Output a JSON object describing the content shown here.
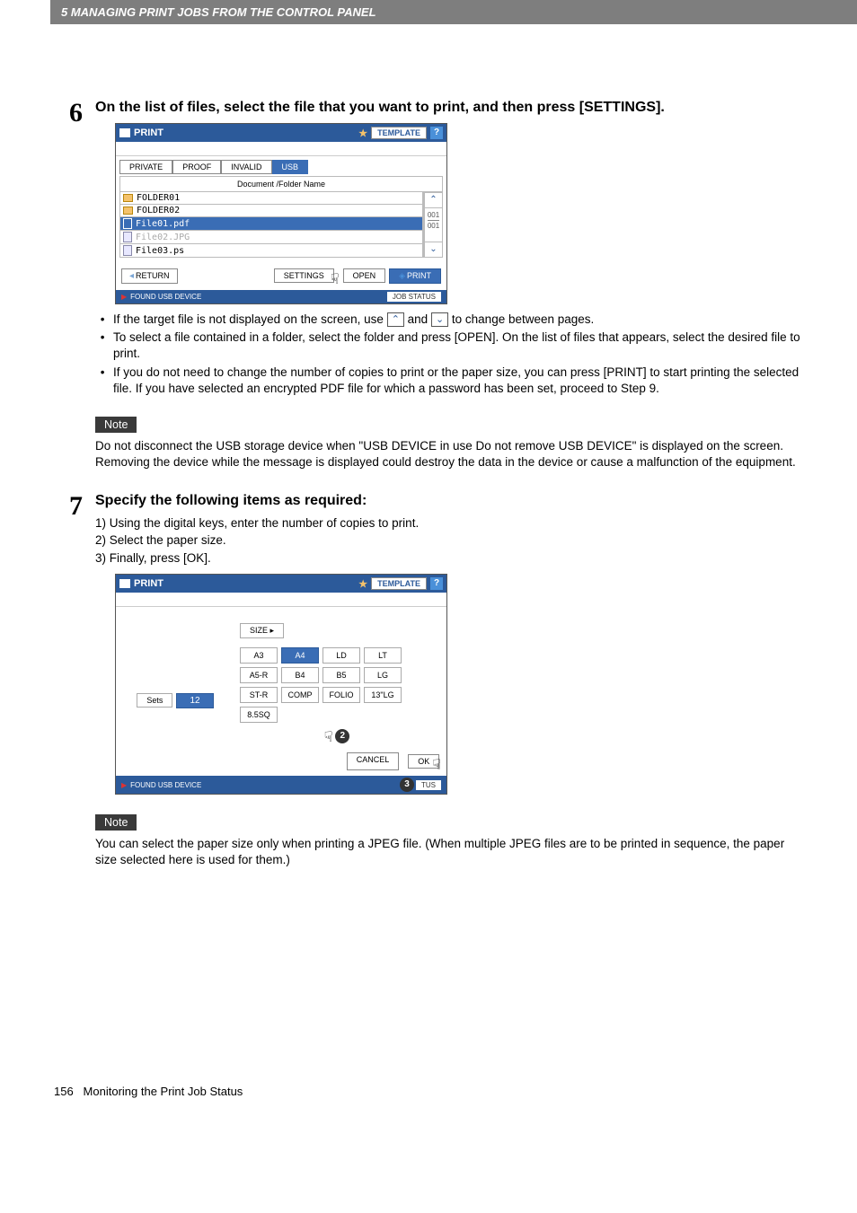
{
  "header": "5 MANAGING PRINT JOBS FROM THE CONTROL PANEL",
  "step6": {
    "num": "6",
    "heading": "On the list of files, select the file that you want to print, and then press [SETTINGS].",
    "ss": {
      "title": "PRINT",
      "template_btn": "TEMPLATE",
      "help": "?",
      "tabs": [
        "PRIVATE",
        "PROOF",
        "INVALID",
        "USB"
      ],
      "active_tab_index": 3,
      "list_header": "Document /Folder Name",
      "rows": [
        {
          "icon": "folder",
          "label": "FOLDER01"
        },
        {
          "icon": "folder",
          "label": "FOLDER02"
        },
        {
          "icon": "file",
          "label": "File01.pdf",
          "selected": true
        },
        {
          "icon": "file",
          "label": "File02.JPG",
          "dim": true
        },
        {
          "icon": "file",
          "label": "File03.ps"
        }
      ],
      "scroll": {
        "up": "⌃",
        "down": "⌄",
        "pg1": "001",
        "pg2": "001"
      },
      "return_btn": "RETURN",
      "settings_btn": "SETTINGS",
      "open_btn": "OPEN",
      "print_btn": "PRINT",
      "status_left": "FOUND USB DEVICE",
      "job_status": "JOB STATUS"
    },
    "bullets": [
      "If the target file is not displayed on the screen, use __UP__ and __DOWN__ to change between pages.",
      "To select a file contained in a folder, select the folder and press [OPEN]. On the list of files that appears, select the desired file to print.",
      "If you do not need to change the number of copies to print or the paper size, you can press [PRINT] to start printing the selected file. If you have selected an encrypted PDF file for which a password has been set, proceed to Step 9."
    ],
    "note_label": "Note",
    "note_text": "Do not disconnect the USB storage device when \"USB DEVICE in use Do not remove USB DEVICE\" is displayed on the screen. Removing the device while the message is displayed could destroy the data in the device or cause a malfunction of the equipment."
  },
  "step7": {
    "num": "7",
    "heading": "Specify the following items as required:",
    "subs": [
      "1)  Using the digital keys, enter the number of copies to print.",
      "2)  Select the paper size.",
      "3)  Finally, press [OK]."
    ],
    "ss": {
      "title": "PRINT",
      "template_btn": "TEMPLATE",
      "help": "?",
      "sets_label": "Sets",
      "sets_val": "12",
      "size_hdr": "SIZE ▸",
      "sizes": [
        "A3",
        "A4",
        "LD",
        "LT",
        "A5-R",
        "B4",
        "B5",
        "LG",
        "ST-R",
        "COMP",
        "FOLIO",
        "13\"LG",
        "8.5SQ"
      ],
      "selected_size": "A4",
      "cancel_btn": "CANCEL",
      "ok_btn": "OK",
      "status_left": "FOUND USB DEVICE",
      "job_status_suffix": "TUS"
    },
    "note_label": "Note",
    "note_text": "You can select the paper size only when printing a JPEG file. (When multiple JPEG files are to be printed in sequence, the paper size selected here is used for them.)"
  },
  "footer": {
    "page_num": "156",
    "title": "Monitoring the Print Job Status"
  }
}
